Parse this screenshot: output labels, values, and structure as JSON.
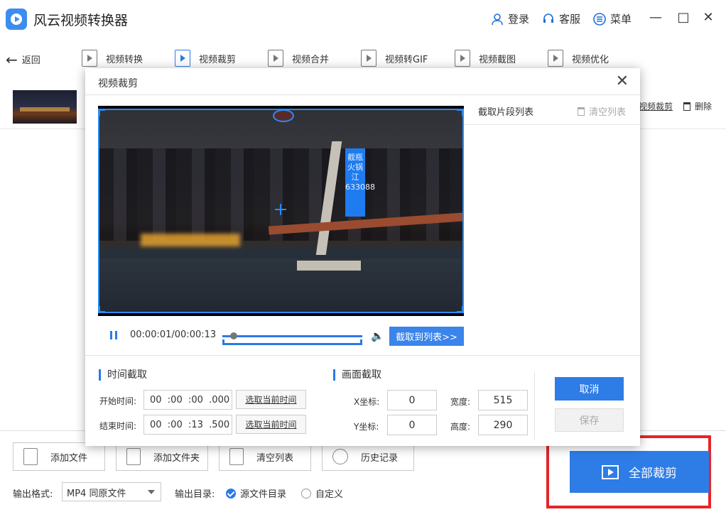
{
  "app": {
    "title": "风云视频转换器"
  },
  "titlebar": {
    "login": "登录",
    "service": "客服",
    "menu": "菜单",
    "minimize": "—",
    "maximize": "□",
    "close": "✕"
  },
  "toolbar": {
    "back": "返回",
    "tools": [
      "视频转换",
      "视频裁剪",
      "视频合并",
      "视频转GIF",
      "视频截图",
      "视频优化"
    ],
    "active_tool": "视频裁剪"
  },
  "file_row": {
    "crop_link": "视频裁剪",
    "delete": "删除"
  },
  "dialog": {
    "title": "视频裁剪",
    "close": "✕",
    "clip_list_title": "截取片段列表",
    "clear_list": "清空列表",
    "video_sign_text": "截瓶火锅江 633088",
    "time_display": "00:00:01/00:00:13",
    "clip_to_list": "截取到列表>>",
    "seek_position_fraction": 0.08,
    "time_section": {
      "title": "时间截取",
      "start_label": "开始时间:",
      "start_value": "00  :00  :00  .000",
      "end_label": "结束时间:",
      "end_value": "00  :00  :13  .500",
      "select_current": "选取当前时间"
    },
    "frame_section": {
      "title": "画面截取",
      "x_label": "X坐标:",
      "x_value": "0",
      "y_label": "Y坐标:",
      "y_value": "0",
      "width_label": "宽度:",
      "width_value": "515",
      "height_label": "高度:",
      "height_value": "290"
    },
    "cancel": "取消",
    "save": "保存"
  },
  "bottom": {
    "add_file": "添加文件",
    "add_folder": "添加文件夹",
    "clear_list": "清空列表",
    "history": "历史记录",
    "output_format_label": "输出格式:",
    "output_format_value": "MP4 同原文件",
    "output_dir_label": "输出目录:",
    "dir_source": "源文件目录",
    "dir_custom": "自定义",
    "dir_selected": "源文件目录",
    "cut_all": "全部裁剪"
  },
  "colors": {
    "accent": "#2e7ce6",
    "highlight_frame": "#e5252a"
  }
}
